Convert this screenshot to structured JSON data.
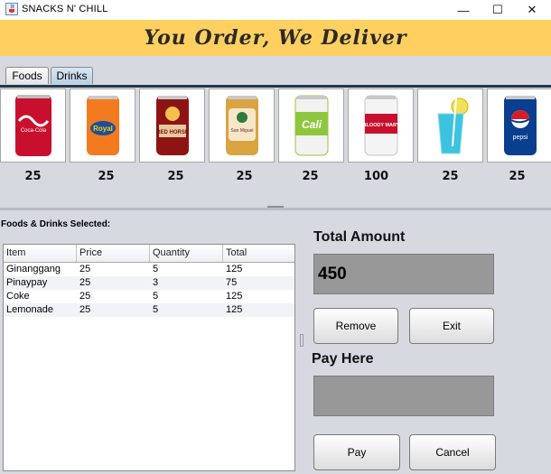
{
  "window": {
    "title": "SNACKS N' CHILL",
    "min_glyph": "—",
    "max_glyph": "☐",
    "close_glyph": "✕"
  },
  "banner": {
    "text": "You Order, We Deliver"
  },
  "tabs": [
    {
      "label": "Foods"
    },
    {
      "label": "Drinks"
    }
  ],
  "products": [
    {
      "name": "coca-cola-can",
      "brand_text": "Coca-Cola",
      "price": "25"
    },
    {
      "name": "royal-can",
      "brand_text": "Royal",
      "price": "25"
    },
    {
      "name": "red-horse-can",
      "brand_text": "RED HORSE",
      "price": "25"
    },
    {
      "name": "san-miguel-flavored-beer-can",
      "brand_text": "San Miguel",
      "price": "25"
    },
    {
      "name": "cali-can",
      "brand_text": "Cali",
      "price": "25"
    },
    {
      "name": "cutwater-bloody-mary-can",
      "brand_text": "BLOODY MARY",
      "price": "100"
    },
    {
      "name": "blue-lemonade-glass",
      "brand_text": "",
      "price": "25"
    },
    {
      "name": "pepsi-can",
      "brand_text": "pepsi",
      "price": "25"
    }
  ],
  "selected": {
    "label": "Foods & Drinks Selected:",
    "columns": [
      "Item",
      "Price",
      "Quantity",
      "Total"
    ],
    "rows": [
      [
        "Ginanggang",
        "25",
        "5",
        "125"
      ],
      [
        "Pinaypay",
        "25",
        "3",
        "75"
      ],
      [
        "Coke",
        "25",
        "5",
        "125"
      ],
      [
        "Lemonade",
        "25",
        "5",
        "125"
      ]
    ]
  },
  "summary": {
    "total_label": "Total Amount",
    "total_value": "450",
    "pay_label": "Pay Here",
    "pay_value": ""
  },
  "buttons": {
    "remove": "Remove",
    "exit": "Exit",
    "pay": "Pay",
    "cancel": "Cancel"
  },
  "colors": {
    "banner": "#ffd060",
    "tab_selected": "#b8cfe3",
    "field": "#989898"
  }
}
